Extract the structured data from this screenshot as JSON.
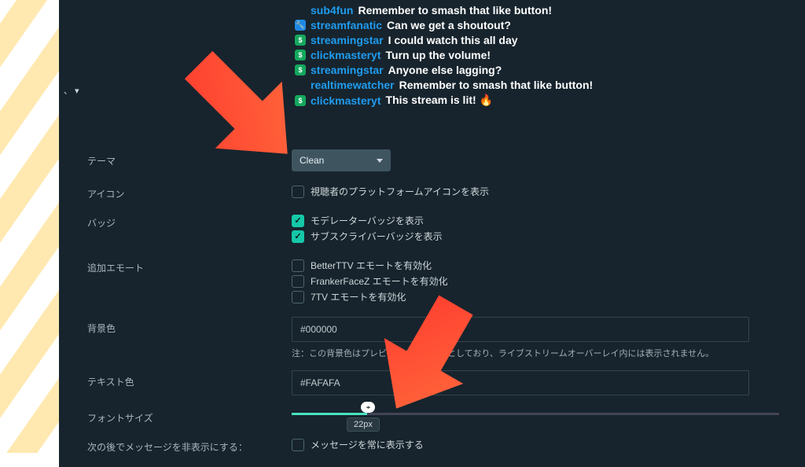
{
  "chat": [
    {
      "badge": "",
      "user": "sub4fun",
      "text": "Remember to smash that like button!"
    },
    {
      "badge": "wrench",
      "user": "streamfanatic",
      "text": "Can we get a shoutout?"
    },
    {
      "badge": "dollar",
      "user": "streamingstar",
      "text": "I could watch this all day"
    },
    {
      "badge": "dollar",
      "user": "clickmasteryt",
      "text": "Turn up the volume!"
    },
    {
      "badge": "dollar",
      "user": "streamingstar",
      "text": "Anyone else lagging?"
    },
    {
      "badge": "",
      "user": "realtimewatcher",
      "text": "Remember to smash that like button!"
    },
    {
      "badge": "dollar",
      "user": "clickmasteryt",
      "text": "This stream is lit! 🔥"
    }
  ],
  "labels": {
    "theme": "テーマ",
    "icon": "アイコン",
    "badge": "バッジ",
    "emotes": "追加エモート",
    "bgcolor": "背景色",
    "textcolor": "テキスト色",
    "fontsize": "フォントサイズ",
    "hideafter": "次の後でメッセージを非表示にする："
  },
  "theme_value": "Clean",
  "checks": {
    "platform_icon": "視聴者のプラットフォームアイコンを表示",
    "mod_badge": "モデレーターバッジを表示",
    "sub_badge": "サブスクライバーバッジを表示",
    "bttv": "BetterTTV エモートを有効化",
    "ffz": "FrankerFaceZ エモートを有効化",
    "stv": "7TV エモートを有効化",
    "always_show": "メッセージを常に表示する"
  },
  "bgcolor_value": "#000000",
  "bgcolor_note": "注：この背景色はプレビューのみを目的としており、ライブストリームオーバーレイ内には表示されません。",
  "textcolor_value": "#FAFAFA",
  "fontsize_value": "22px",
  "dropdown_hint": "、 ▾"
}
